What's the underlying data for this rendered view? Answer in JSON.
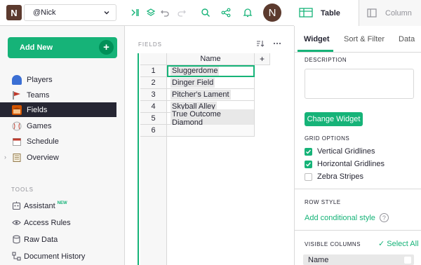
{
  "topbar": {
    "logo_letter": "N",
    "org_name": "@Nick",
    "avatar_letter": "N",
    "icons": [
      "panel-toggle-icon",
      "layers-icon",
      "undo-icon",
      "redo-icon",
      "search-icon",
      "share-icon",
      "bell-icon"
    ]
  },
  "left": {
    "add_new_label": "Add New",
    "pages": [
      {
        "label": "Players",
        "icon": "player-icon",
        "color": "#3b6fd4"
      },
      {
        "label": "Teams",
        "icon": "flag-icon",
        "color": "#c0392b"
      },
      {
        "label": "Fields",
        "icon": "stadium-icon",
        "color": "#d35400",
        "active": true
      },
      {
        "label": "Games",
        "icon": "baseball-icon",
        "color": "#e0e0e0"
      },
      {
        "label": "Schedule",
        "icon": "calendar-icon",
        "color": "#f0f0f0"
      },
      {
        "label": "Overview",
        "icon": "notebook-icon",
        "color": "#e8e8e8"
      }
    ],
    "tools_label": "TOOLS",
    "tools": [
      {
        "label": "Assistant",
        "badge": "NEW",
        "icon": "assistant-icon"
      },
      {
        "label": "Access Rules",
        "icon": "eye-icon"
      },
      {
        "label": "Raw Data",
        "icon": "database-icon"
      },
      {
        "label": "Document History",
        "icon": "history-icon"
      }
    ]
  },
  "main": {
    "widget_title": "FIELDS",
    "column_header": "Name",
    "add_column_label": "+",
    "rows": [
      {
        "num": "1",
        "name": "Sluggerdome"
      },
      {
        "num": "2",
        "name": "Dinger Field"
      },
      {
        "num": "3",
        "name": "Pitcher's Lament"
      },
      {
        "num": "4",
        "name": "Skyball Alley"
      },
      {
        "num": "5",
        "name": "True Outcome Diamond"
      },
      {
        "num": "6",
        "name": ""
      }
    ]
  },
  "right": {
    "tab_table": "Table",
    "tab_column": "Column",
    "subtabs": [
      "Widget",
      "Sort & Filter",
      "Data"
    ],
    "description_label": "DESCRIPTION",
    "change_widget_label": "Change Widget",
    "grid_options_label": "GRID OPTIONS",
    "grid_options": [
      {
        "label": "Vertical Gridlines",
        "checked": true
      },
      {
        "label": "Horizontal Gridlines",
        "checked": true
      },
      {
        "label": "Zebra Stripes",
        "checked": false
      }
    ],
    "row_style_label": "ROW STYLE",
    "add_conditional_style": "Add conditional style",
    "visible_columns_label": "VISIBLE COLUMNS",
    "select_all": "Select All",
    "visible_columns": [
      "Name"
    ]
  },
  "colors": {
    "accent": "#16b378",
    "dark": "#262633",
    "logo": "#5c3a2e"
  }
}
